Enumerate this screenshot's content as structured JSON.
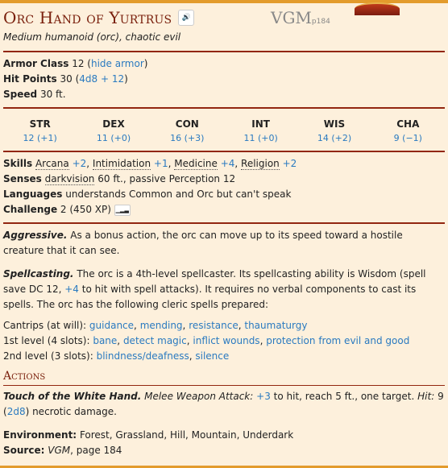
{
  "title": "Orc Hand of Yurtrus",
  "source": {
    "book": "VGM",
    "page": "p184"
  },
  "subtitle": "Medium humanoid (orc), chaotic evil",
  "ac": {
    "label": "Armor Class",
    "value": "12",
    "armor": "hide armor"
  },
  "hp": {
    "label": "Hit Points",
    "value": "30",
    "dice": "4d8 + 12"
  },
  "speed": {
    "label": "Speed",
    "value": "30 ft."
  },
  "abilities": [
    {
      "name": "STR",
      "value": "12 (+1)"
    },
    {
      "name": "DEX",
      "value": "11 (+0)"
    },
    {
      "name": "CON",
      "value": "16 (+3)"
    },
    {
      "name": "INT",
      "value": "11 (+0)"
    },
    {
      "name": "WIS",
      "value": "14 (+2)"
    },
    {
      "name": "CHA",
      "value": "9 (−1)"
    }
  ],
  "skills": {
    "label": "Skills",
    "items": [
      {
        "name": "Arcana",
        "mod": "+2"
      },
      {
        "name": "Intimidation",
        "mod": "+1"
      },
      {
        "name": "Medicine",
        "mod": "+4"
      },
      {
        "name": "Religion",
        "mod": "+2"
      }
    ]
  },
  "senses": {
    "label": "Senses",
    "sense": "darkvision",
    "rest": "60 ft., passive Perception 12"
  },
  "languages": {
    "label": "Languages",
    "value": "understands Common and Orc but can't speak"
  },
  "challenge": {
    "label": "Challenge",
    "value": "2 (450 XP)"
  },
  "traits": {
    "aggressive": {
      "name": "Aggressive.",
      "text": "As a bonus action, the orc can move up to its speed toward a hostile creature that it can see."
    },
    "spell": {
      "name": "Spellcasting.",
      "t1": "The orc is a 4th-level spellcaster. Its spellcasting ability is Wisdom (spell save DC 12,",
      "mod": "+4",
      "t2": "to hit with spell attacks). It requires no verbal components to cast its spells. The orc has the following cleric spells prepared:"
    },
    "cantrips": {
      "label": "Cantrips (at will):",
      "spells": [
        "guidance",
        "mending",
        "resistance",
        "thaumaturgy"
      ]
    },
    "first": {
      "label": "1st level (4 slots):",
      "spells": [
        "bane",
        "detect magic",
        "inflict wounds",
        "protection from evil and good"
      ]
    },
    "second": {
      "label": "2nd level (3 slots):",
      "spells": [
        "blindness/deafness",
        "silence"
      ]
    }
  },
  "actions": {
    "heading": "Actions",
    "touch": {
      "name": "Touch of the White Hand.",
      "type": "Melee Weapon Attack:",
      "mod": "+3",
      "t1": "to hit, reach 5 ft., one target.",
      "hit": "Hit:",
      "dmg": "9",
      "dice": "2d8",
      "t2": "necrotic damage."
    }
  },
  "environment": {
    "label": "Environment:",
    "value": "Forest, Grassland, Hill, Mountain, Underdark"
  },
  "source_line": {
    "label": "Source:",
    "book": "VGM",
    "rest": ", page 184"
  }
}
